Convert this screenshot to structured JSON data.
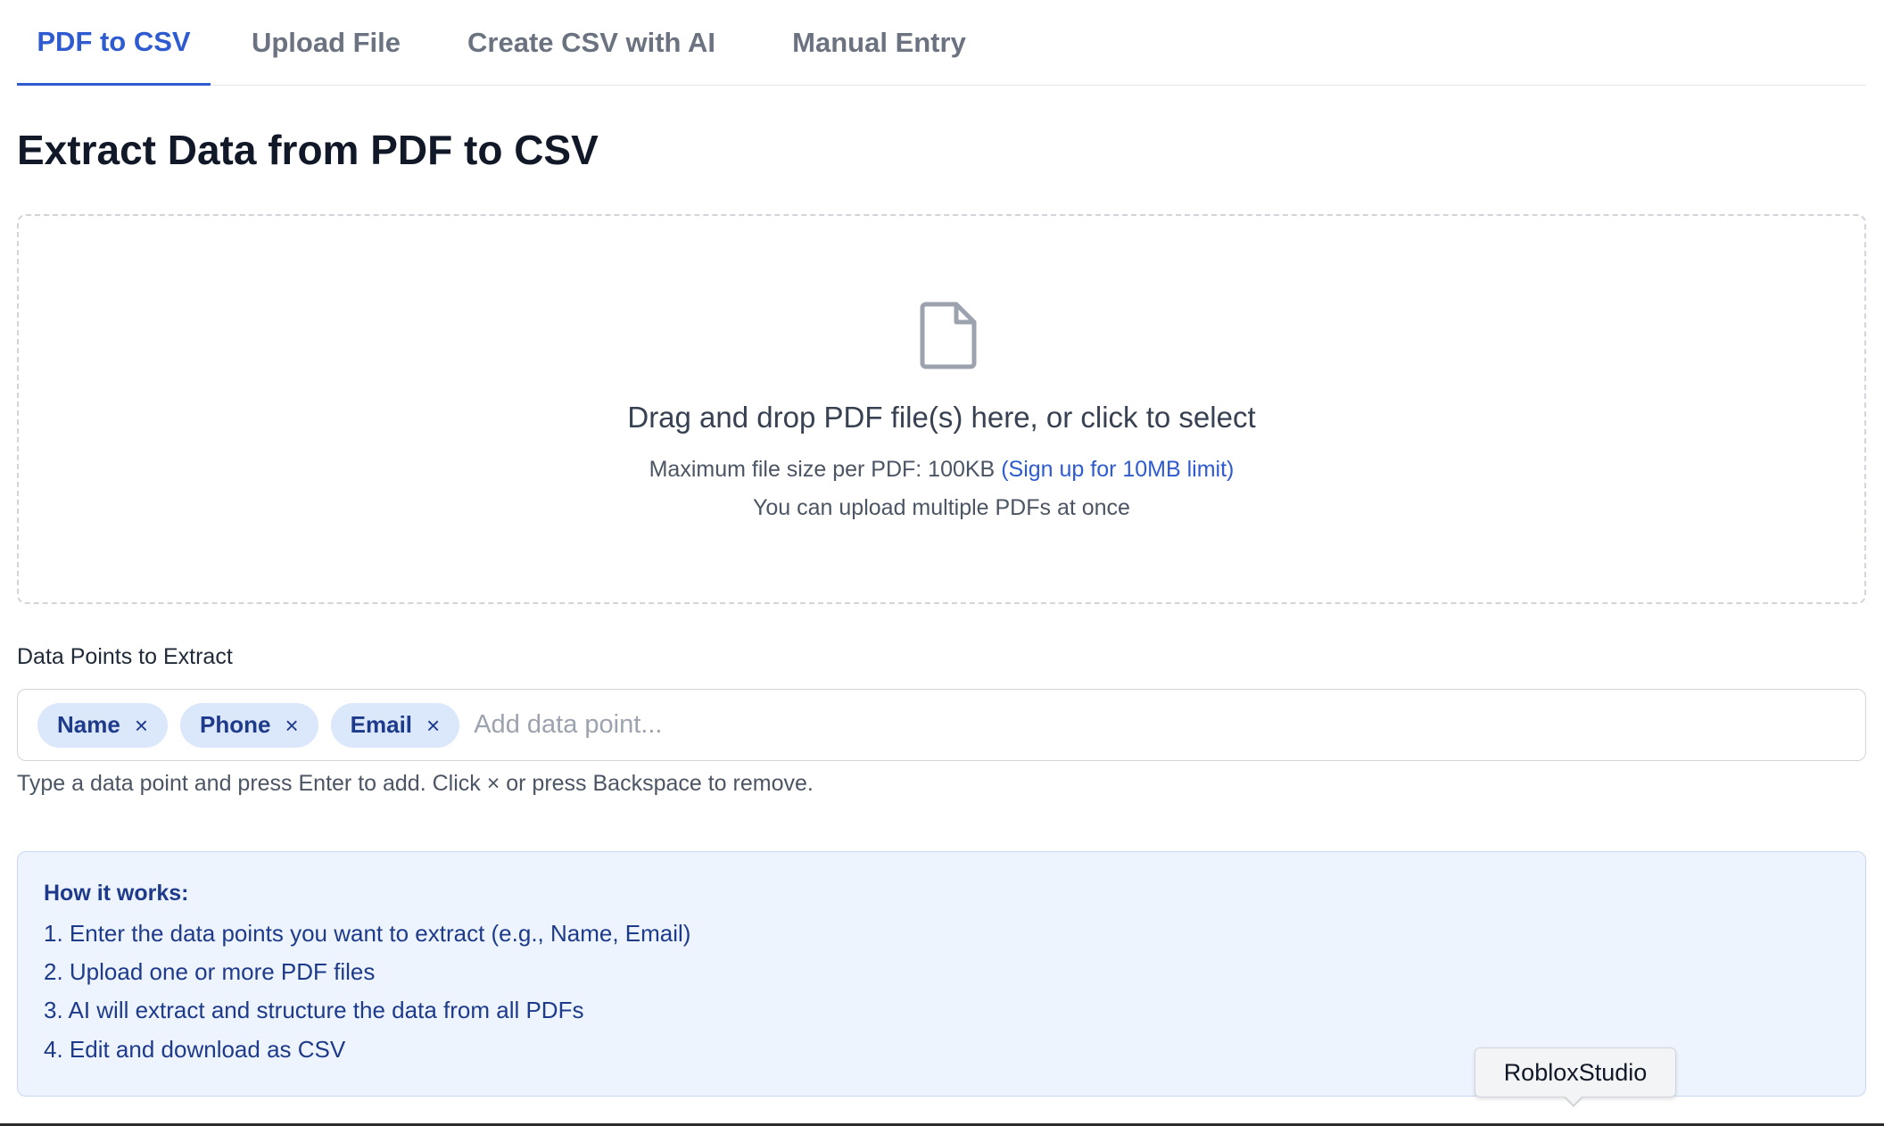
{
  "tabs": [
    {
      "label": "PDF to CSV",
      "active": true
    },
    {
      "label": "Upload File",
      "active": false
    },
    {
      "label": "Create CSV with AI",
      "active": false
    },
    {
      "label": "Manual Entry",
      "active": false
    }
  ],
  "page_title": "Extract Data from PDF to CSV",
  "dropzone": {
    "icon": "file-icon",
    "main_text": "Drag and drop PDF file(s) here, or click to select",
    "size_text": "Maximum file size per PDF: 100KB",
    "signup_link": "(Sign up for 10MB limit)",
    "multi_text": "You can upload multiple PDFs at once"
  },
  "data_points": {
    "label": "Data Points to Extract",
    "chips": [
      "Name",
      "Phone",
      "Email"
    ],
    "remove_glyph": "×",
    "placeholder": "Add data point...",
    "help": "Type a data point and press Enter to add. Click × or press Backspace to remove."
  },
  "how_it_works": {
    "title": "How it works:",
    "steps": [
      "1. Enter the data points you want to extract (e.g., Name, Email)",
      "2. Upload one or more PDF files",
      "3. AI will extract and structure the data from all PDFs",
      "4. Edit and download as CSV"
    ]
  },
  "tooltip": {
    "text": "RobloxStudio"
  },
  "colors": {
    "accent": "#2f5bd0",
    "chip_bg": "#dbe7fb",
    "chip_text": "#1e3a8a",
    "info_bg": "#eef4fd"
  }
}
